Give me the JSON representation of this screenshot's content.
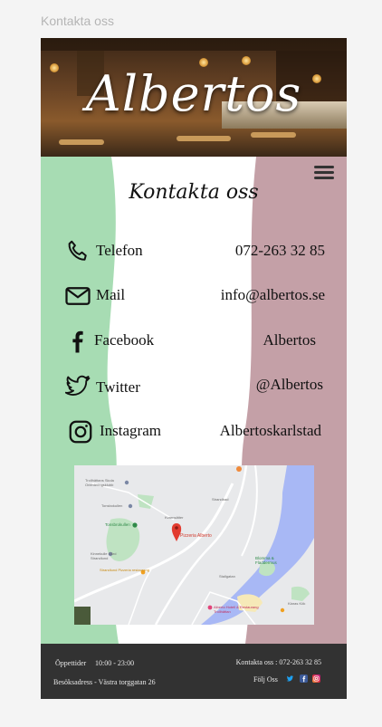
{
  "window": {
    "title": "Kontakta oss"
  },
  "hero": {
    "logo_text": "Albertos"
  },
  "page": {
    "heading": "Kontakta oss"
  },
  "contacts": [
    {
      "label": "Telefon",
      "value": "072-263 32 85",
      "icon": "phone-icon"
    },
    {
      "label": "Mail",
      "value": "info@albertos.se",
      "icon": "mail-icon"
    },
    {
      "label": "Facebook",
      "value": "Albertos",
      "icon": "facebook-icon"
    },
    {
      "label": "Twitter",
      "value": "@Albertos",
      "icon": "twitter-icon"
    },
    {
      "label": "Instagram",
      "value": "Albertoskarlstad",
      "icon": "instagram-icon"
    }
  ],
  "map": {
    "pin_label": "Pizzeria Alberto",
    "labels": [
      "Trollhättans Skola Orienteringsklubb",
      "Tonsbokullen",
      "Tonsbrokullen",
      "Kvarnsätter",
      "Strandbad",
      "Kinnekulle Gård Strandlund",
      "Strandlund Pizzeria restaurang",
      "Blomma & Fladdermus",
      "Stallgatan",
      "Alberto Hotell & Restaurang Trollhättan",
      "Klaras Kök"
    ]
  },
  "footer": {
    "hours_label": "Öppettider",
    "hours_value": "10:00 - 23:00",
    "address_label": "Besöksadress - Västra torggatan 26",
    "contact_label": "Kontakta oss : 072-263 32 85",
    "follow_label": "Följ Oss"
  },
  "colors": {
    "left_band": "#a7dcb3",
    "right_band": "#c4a0a7",
    "footer_bg": "#323232",
    "twitter": "#1da1f2",
    "facebook": "#3b5998",
    "instagram": "#d6249f"
  }
}
